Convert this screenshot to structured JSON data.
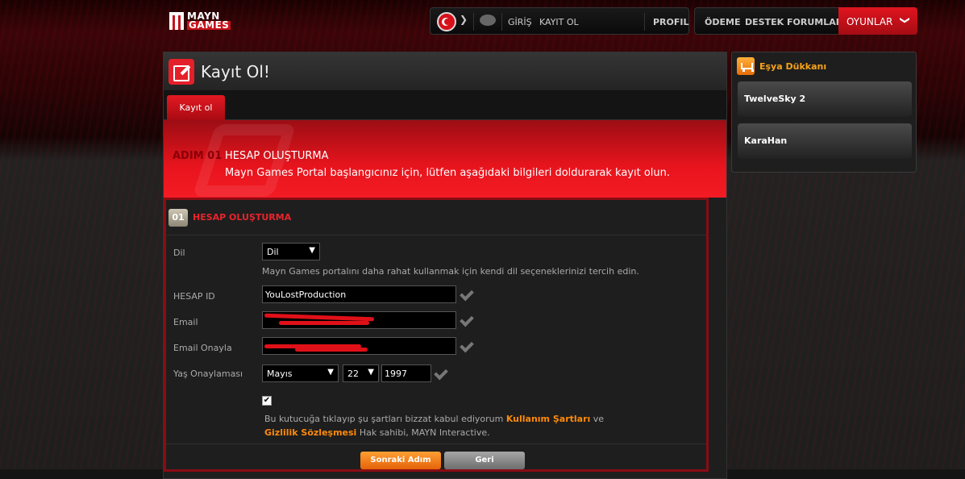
{
  "brand": {
    "logo_top": "MAYN",
    "logo_bottom": "GAMES"
  },
  "nav": {
    "login": "GİRİŞ",
    "register": "KAYIT OL",
    "profile": "PROFIL",
    "payment": "ÖDEME",
    "support": "DESTEK",
    "forums": "FORUMLAR",
    "games": "OYUNLAR",
    "games_chevron": "❯"
  },
  "page": {
    "title": "Kayıt Ol!",
    "tab": "Kayıt ol"
  },
  "banner": {
    "step": "ADIM 01",
    "title": "HESAP OLUŞTURMA",
    "description": "Mayn Games Portal başlangıcınız için, lütfen aşağıdaki bilgileri doldurarak kayıt olun."
  },
  "form": {
    "section_number": "01",
    "section_title": "HESAP OLUŞTURMA",
    "language_label": "Dil",
    "language_value": "Dil",
    "language_help": "Mayn Games portalını daha rahat kullanmak için kendi dil seçeneklerinizi tercih edin.",
    "account_label": "HESAP ID",
    "account_value": "YouLostProduction",
    "email_label": "Email",
    "email_confirm_label": "Email Onayla",
    "age_label": "Yaş Onaylaması",
    "month_value": "Mayıs",
    "day_value": "22",
    "year_value": "1997",
    "checkbox_mark": "✔",
    "terms_before": "Bu kutucuğa tıklayıp şu şartları bizzat kabul ediyorum ",
    "terms_link1": "Kullanım Şartları",
    "terms_mid": " ve ",
    "terms_link2": "Gizlilik Sözleşmesi",
    "terms_after": " Hak sahibi, MAYN Interactive.",
    "next_button": "Sonraki Adım",
    "back_button": "Geri"
  },
  "shop": {
    "title": "Eşya Dükkanı",
    "items": [
      "TwelveSky 2",
      "KaraHan"
    ]
  }
}
